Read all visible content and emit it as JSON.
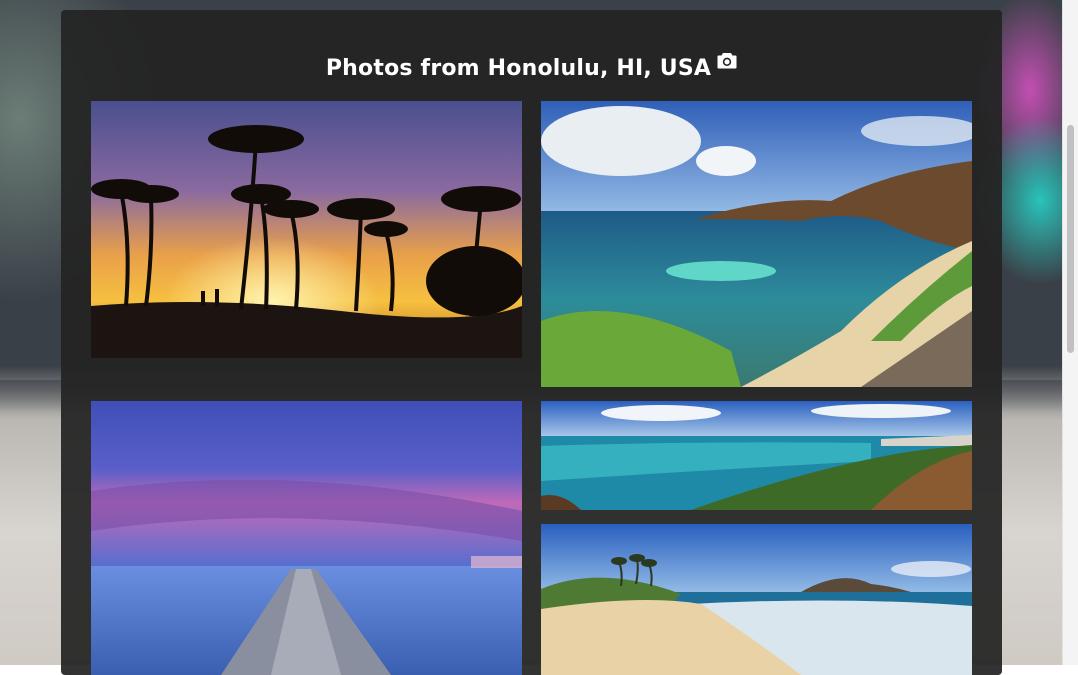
{
  "header": {
    "title": "Photos from Honolulu, HI, USA",
    "title_icon": "camera-icon"
  },
  "gallery": {
    "photos": [
      {
        "name": "photo-sunset-palms"
      },
      {
        "name": "photo-hanauma-bay"
      },
      {
        "name": "photo-pier-dusk"
      },
      {
        "name": "photo-coastline-panorama"
      },
      {
        "name": "photo-sandy-beach"
      }
    ]
  },
  "colors": {
    "panel_bg": "#242424",
    "title_text": "#ffffff",
    "scrollbar_thumb": "#c1c1c1"
  }
}
